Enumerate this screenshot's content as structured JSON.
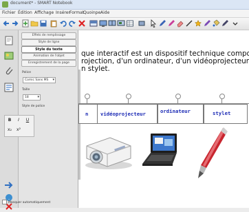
{
  "window": {
    "title": "document* - SMART Notebook"
  },
  "menu": [
    "Fichier",
    "Édition",
    "Affichage",
    "Insérer",
    "Format",
    "Quoinpe",
    "Aide"
  ],
  "properties": {
    "tabs": [
      "Effets de remplissage",
      "Style de ligne",
      "Style du texte",
      "Animation de l'objet",
      "Enregistrement de la page"
    ],
    "active_tab": "Style du texte",
    "font_label": "Police",
    "font_value": "Comic Sans MS",
    "size_label": "Taille",
    "size_value": "18",
    "style_label": "Style de police",
    "style_buttons": [
      "B",
      "I",
      "U",
      "x₂",
      "x²"
    ],
    "autohide_label": "Masquer automatiquement"
  },
  "page": {
    "intro_line1": "que interactif est un dispositif technique composé",
    "intro_line2": "rojection, d'un ordinateur, d'un vidéoprojecteur et,",
    "intro_line3": "n stylet.",
    "labels": [
      "n",
      "vidéoprojecteur",
      "ordinateur",
      "stylet"
    ]
  },
  "colors": {
    "label_text": "#1c2bb5",
    "pen_body": "#c8262f"
  }
}
